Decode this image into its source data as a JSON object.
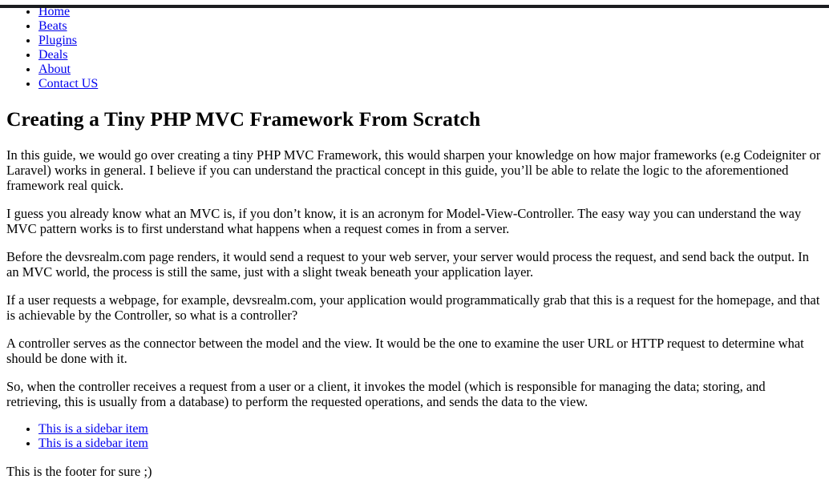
{
  "document": {
    "title": "Creating a Tiny PHP MVC Framework From Scratch"
  },
  "nav": {
    "items": [
      {
        "label": "Home"
      },
      {
        "label": "Beats"
      },
      {
        "label": "Plugins"
      },
      {
        "label": "Deals"
      },
      {
        "label": "About"
      },
      {
        "label": "Contact US"
      }
    ]
  },
  "article": {
    "heading": "Creating a Tiny PHP MVC Framework From Scratch",
    "paragraphs": [
      "In this guide, we would go over creating a tiny PHP MVC Framework, this would sharpen your knowledge on how major frameworks (e.g Codeigniter or Laravel) works in general. I believe if you can understand the practical concept in this guide, you’ll be able to relate the logic to the aforementioned framework real quick.",
      "I guess you already know what an MVC is, if you don’t know, it is an acronym for Model-View-Controller. The easy way you can understand the way MVC pattern works is to first understand what happens when a request comes in from a server.",
      "Before the devsrealm.com page renders, it would send a request to your web server, your server would process the request, and send back the output. In an MVC world, the process is still the same, just with a slight tweak beneath your application layer.",
      "If a user requests a webpage, for example, devsrealm.com, your application would programmatically grab that this is a request for the homepage, and that is achievable by the Controller, so what is a controller?",
      "A controller serves as the connector between the model and the view. It would be the one to examine the user URL or HTTP request to determine what should be done with it.",
      "So, when the controller receives a request from a user or a client, it invokes the model (which is responsible for managing the data; storing, and retrieving, this is usually from a database) to perform the requested operations, and sends the data to the view."
    ]
  },
  "sidebar": {
    "items": [
      {
        "label": "This is a sidebar item"
      },
      {
        "label": "This is a sidebar item"
      }
    ]
  },
  "footer": {
    "text": "This is the footer for sure ;)"
  },
  "colors": {
    "link": "#0000ee",
    "text": "#000000",
    "background": "#ffffff",
    "chrome_edge": "#1b1d20"
  }
}
